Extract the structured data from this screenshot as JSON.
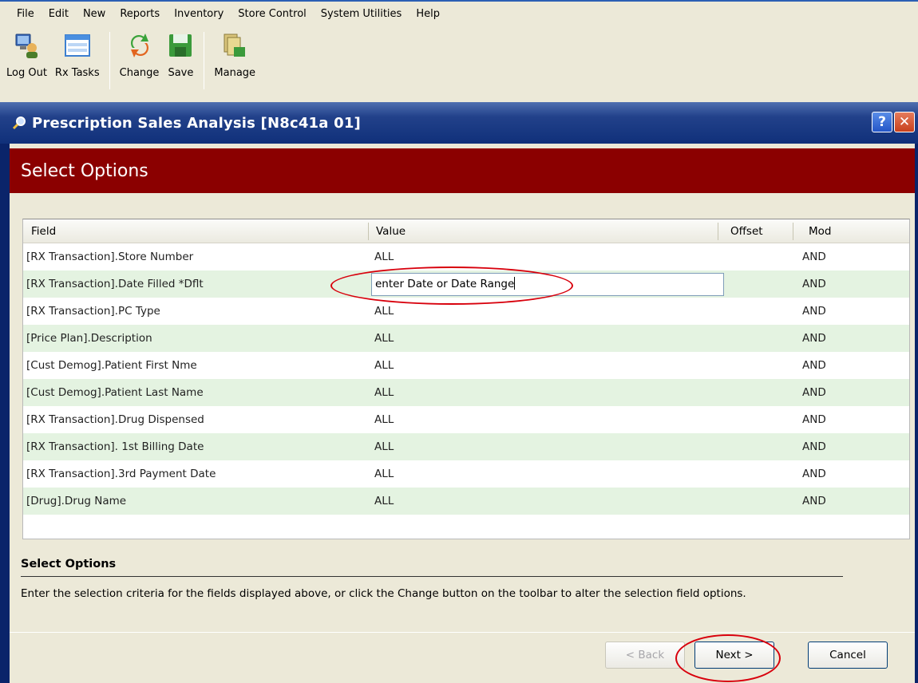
{
  "menu": [
    "File",
    "Edit",
    "New",
    "Reports",
    "Inventory",
    "Store Control",
    "System Utilities",
    "Help"
  ],
  "toolbar": {
    "logout": "Log Out",
    "rxtasks": "Rx Tasks",
    "change": "Change",
    "save": "Save",
    "manage": "Manage"
  },
  "dialog": {
    "title": "Prescription Sales Analysis [N8c41a 01]",
    "help_label": "?",
    "close_label": "✕",
    "header": "Select Options"
  },
  "grid": {
    "columns": {
      "field": "Field",
      "value": "Value",
      "offset": "Offset",
      "mod": "Mod"
    },
    "rows": [
      {
        "field": "[RX Transaction].Store Number",
        "value": "ALL",
        "mod": "AND"
      },
      {
        "field": "[RX Transaction].Date Filled *Dflt",
        "value": "enter Date or Date Range",
        "mod": "AND"
      },
      {
        "field": "[RX Transaction].PC Type",
        "value": "ALL",
        "mod": "AND"
      },
      {
        "field": "[Price Plan].Description",
        "value": "ALL",
        "mod": "AND"
      },
      {
        "field": "[Cust Demog].Patient First Nme",
        "value": "ALL",
        "mod": "AND"
      },
      {
        "field": "[Cust Demog].Patient Last Name",
        "value": "ALL",
        "mod": "AND"
      },
      {
        "field": "[RX Transaction].Drug Dispensed",
        "value": "ALL",
        "mod": "AND"
      },
      {
        "field": "[RX Transaction]. 1st Billing Date",
        "value": "ALL",
        "mod": "AND"
      },
      {
        "field": "[RX Transaction].3rd Payment Date",
        "value": "ALL",
        "mod": "AND"
      },
      {
        "field": "[Drug].Drug Name",
        "value": "ALL",
        "mod": "AND"
      }
    ]
  },
  "help": {
    "heading": "Select Options",
    "text": "Enter the selection criteria for the fields displayed above, or click the Change button on the toolbar to alter the selection field options."
  },
  "buttons": {
    "back": "< Back",
    "next": "Next >",
    "cancel": "Cancel"
  },
  "colors": {
    "header_band": "#8b0000",
    "alt_row": "#e4f3e1",
    "annotation": "#d8000c"
  }
}
